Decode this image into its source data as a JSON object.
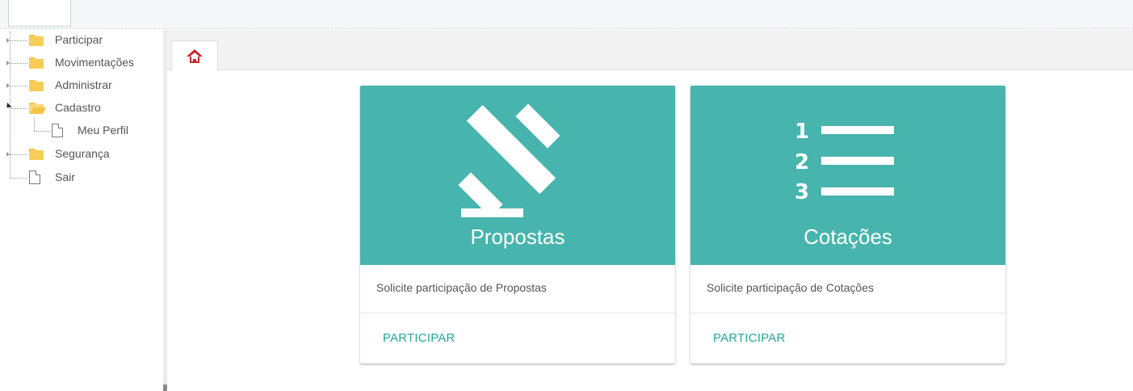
{
  "sidebar": {
    "items": [
      {
        "label": "Participar",
        "icon": "folder-icon"
      },
      {
        "label": "Movimentações",
        "icon": "folder-icon"
      },
      {
        "label": "Administrar",
        "icon": "folder-icon"
      },
      {
        "label": "Cadastro",
        "icon": "folder-open-icon"
      },
      {
        "label": "Meu Perfil",
        "icon": "page-icon"
      },
      {
        "label": "Segurança",
        "icon": "folder-icon"
      },
      {
        "label": "Sair",
        "icon": "page-icon"
      }
    ]
  },
  "tabs": {
    "home": {
      "icon": "home-icon"
    }
  },
  "cards": [
    {
      "title": "Propostas",
      "icon": "gavel-icon",
      "description": "Solicite participação de Propostas",
      "action": "PARTICIPAR"
    },
    {
      "title": "Cotações",
      "icon": "numbered-list-icon",
      "numbers": [
        "1",
        "2",
        "3"
      ],
      "description": "Solicite participação de Cotações",
      "action": "PARTICIPAR"
    }
  ],
  "colors": {
    "card_media": "#47b4ad",
    "action_text": "#26a69a",
    "folder": "#f6cd57",
    "home_icon": "#c62828"
  }
}
